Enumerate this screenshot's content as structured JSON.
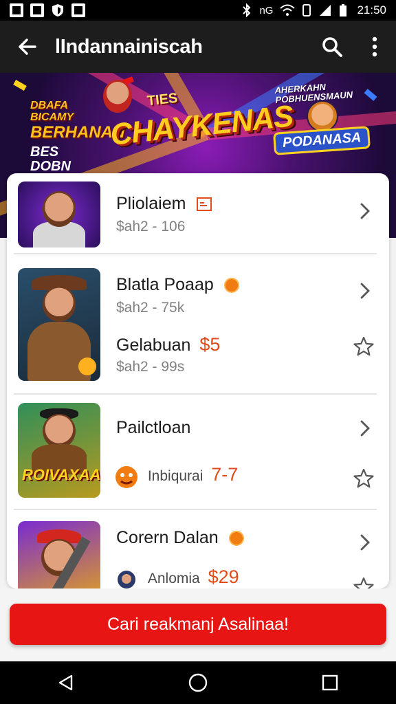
{
  "status_bar": {
    "time": "21:50",
    "network_label": "nG",
    "left_icons": [
      "a-app-icon",
      "image-app-icon",
      "shield-app-icon",
      "send-app-icon"
    ],
    "right_icons": [
      "bluetooth-icon",
      "wifi-icon",
      "vibrate-icon",
      "signal-icon",
      "battery-icon"
    ]
  },
  "app_bar": {
    "title": "lIndannainiscah",
    "back_icon": "arrow-left-icon",
    "search_icon": "search-icon",
    "menu_icon": "more-vert-icon"
  },
  "banner": {
    "left_line1": "DBAFA BICAMY",
    "left_line2": "BERHANAN",
    "left_line3": "BES DOBN",
    "title": "CHAYKENAS",
    "subtitle": "TIES",
    "right_text": "AHERKAHN POBHUENSMAUN",
    "badge": "PODANASA"
  },
  "list": {
    "items": [
      {
        "name": "Pliolaiem",
        "name_icon": "calendar-icon",
        "price": "$ah2 - 106"
      },
      {
        "name": "Blatla Poaap",
        "name_icon": "coin-icon",
        "price": "$ah2 - 75k"
      },
      {
        "name": "Gelabuan",
        "accent": "$5",
        "price": "$ah2 - 99s"
      },
      {
        "name": "Pailctloan",
        "detail": "Inbiqurai",
        "detail_value": "7-7",
        "detail_icon": "monster-icon"
      },
      {
        "name": "Corern Dalan",
        "name_icon": "coin-icon",
        "detail": "Anlomia",
        "detail_value": "$29",
        "detail_icon": "avatar-icon"
      }
    ],
    "thumb_captions": [
      "",
      "",
      "",
      "ROIVAXAAN",
      ""
    ]
  },
  "cta": {
    "label": "Cari reakmanj Asalinaa!"
  },
  "nav": {
    "back": "nav-back-icon",
    "home": "nav-home-icon",
    "recents": "nav-recents-icon"
  },
  "colors": {
    "app_bar": "#1d1d1d",
    "cta": "#e81515",
    "accent_price": "#e04d1a",
    "coin": "#f07c12"
  }
}
